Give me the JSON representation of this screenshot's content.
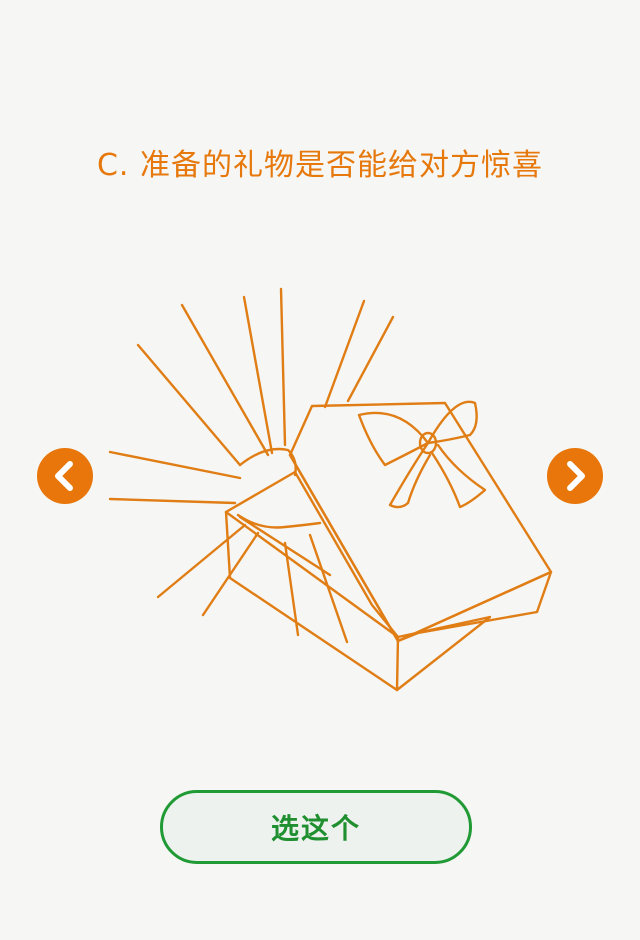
{
  "question": {
    "text": "C. 准备的礼物是否能给对方惊喜"
  },
  "illustration": {
    "icon": "gift-box-icon"
  },
  "navigation": {
    "prev_icon": "chevron-left-icon",
    "next_icon": "chevron-right-icon"
  },
  "actions": {
    "choose_label": "选这个"
  },
  "colors": {
    "accent": "#e8760a",
    "button": "#1f9a34"
  }
}
